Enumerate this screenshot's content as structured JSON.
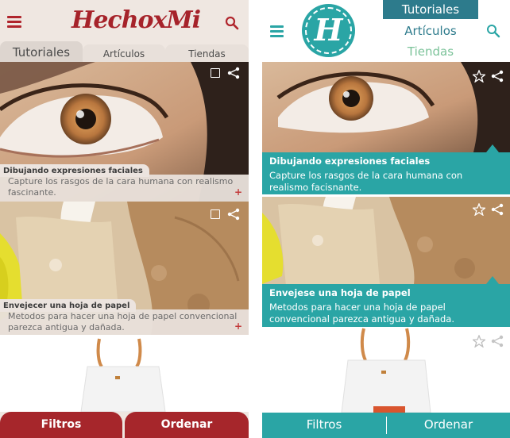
{
  "left": {
    "logo": "HechoxMi",
    "tabs": [
      "Tutoriales",
      "Artículos",
      "Tiendas"
    ],
    "cards": [
      {
        "title": "Dibujando expresiones faciales",
        "description": "Capture los rasgos de la cara humana con realismo fascinante.",
        "more": "+"
      },
      {
        "title": "Envejecer una hoja de papel",
        "description": "Metodos para hacer una hoja de papel convencional parezca antigua y dañada.",
        "more": "+"
      }
    ],
    "bottom": {
      "filter_label": "Filtros",
      "sort_label": "Ordenar"
    },
    "colors": {
      "brand": "#a6232a",
      "background": "#efe7e1"
    },
    "icons": [
      "menu-icon",
      "search-icon",
      "checkbox-icon",
      "share-icon"
    ]
  },
  "right": {
    "logo_letter": "H",
    "tabs": {
      "active": "Tutoriales",
      "second": "Artículos",
      "third": "Tiendas"
    },
    "cards": [
      {
        "title": "Dibujando expresiones faciales",
        "description": "Capture los rasgos de la cara humana con realismo facisnante."
      },
      {
        "title": "Envejese una hoja de papel",
        "description": "Metodos para hacer una hoja de papel convencional parezca antigua y dañada."
      }
    ],
    "bottom": {
      "filter_label": "Filtros",
      "sort_label": "Ordenar"
    },
    "colors": {
      "brand": "#2aa5a5",
      "active_tab": "#2d7b8c",
      "tab_third": "#7cc39a"
    },
    "icons": [
      "menu-icon",
      "search-icon",
      "star-icon",
      "share-icon"
    ]
  }
}
